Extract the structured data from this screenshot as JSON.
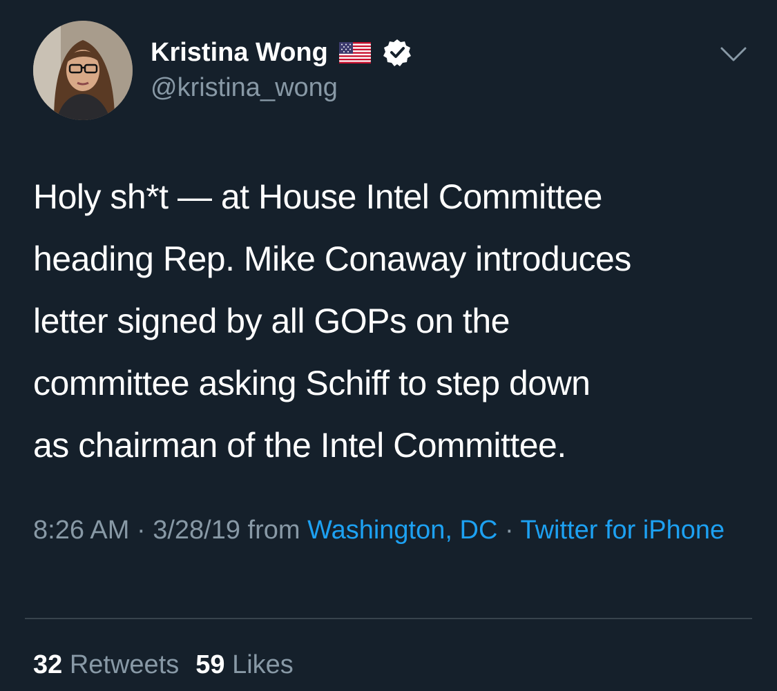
{
  "author": {
    "display_name": "Kristina Wong",
    "handle": "@kristina_wong",
    "flag_icon": "us-flag-icon",
    "verified_icon": "verified-badge-icon",
    "menu_icon": "chevron-down-icon"
  },
  "tweet": {
    "text": "Holy sh*t — at House Intel Committee\nheading Rep. Mike Conaway introduces\nletter signed by all GOPs on the\ncommittee asking Schiff to step down\nas chairman of the Intel Committee."
  },
  "meta": {
    "time": "8:26 AM",
    "sep1": " · ",
    "date": "3/28/19",
    "from": " from ",
    "location": "Washington, DC",
    "sep2": " · ",
    "source": "Twitter for iPhone"
  },
  "stats": {
    "retweets_count": "32",
    "retweets_label": "Retweets",
    "likes_count": "59",
    "likes_label": "Likes"
  },
  "colors": {
    "background": "#15202b",
    "link": "#1da1f2",
    "secondary_text": "#8899a6",
    "divider": "#38444d"
  }
}
